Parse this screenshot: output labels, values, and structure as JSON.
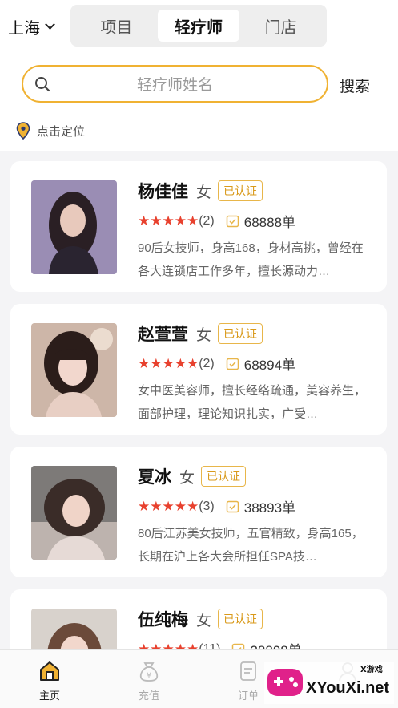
{
  "header": {
    "city": "上海",
    "tabs": [
      "项目",
      "轻疗师",
      "门店"
    ],
    "active_tab": "轻疗师"
  },
  "search": {
    "placeholder": "轻疗师姓名",
    "button_label": "搜索"
  },
  "location": {
    "label": "点击定位"
  },
  "therapists": [
    {
      "name": "杨佳佳",
      "gender": "女",
      "badge": "已认证",
      "rating": 5,
      "reviews": "(2)",
      "orders": "68888单",
      "desc": "90后女技师，身高168，身材高挑，曾经在各大连锁店工作多年，擅长源动力…"
    },
    {
      "name": "赵萱萱",
      "gender": "女",
      "badge": "已认证",
      "rating": 5,
      "reviews": "(2)",
      "orders": "68894单",
      "desc": "女中医美容师，擅长经络疏通，美容养生，面部护理，理论知识扎实，广受…"
    },
    {
      "name": "夏冰",
      "gender": "女",
      "badge": "已认证",
      "rating": 5,
      "reviews": "(3)",
      "orders": "38893单",
      "desc": "80后江苏美女技师，五官精致，身高165，长期在沪上各大会所担任SPA技…"
    },
    {
      "name": "伍纯梅",
      "gender": "女",
      "badge": "已认证",
      "rating": 5,
      "reviews": "(11)",
      "orders": "38898单",
      "desc": ""
    }
  ],
  "tabbar": {
    "items": [
      {
        "label": "主页",
        "icon": "home-icon",
        "active": true
      },
      {
        "label": "充值",
        "icon": "money-bag-icon",
        "active": false
      },
      {
        "label": "订单",
        "icon": "order-icon",
        "active": false
      },
      {
        "label": "",
        "icon": "profile-icon",
        "active": false
      }
    ]
  },
  "watermark": {
    "text": "XYouXi.net",
    "small": "X游戏"
  },
  "colors": {
    "accent": "#f0b233",
    "star": "#e8412e",
    "badge": "#d99a1b"
  }
}
